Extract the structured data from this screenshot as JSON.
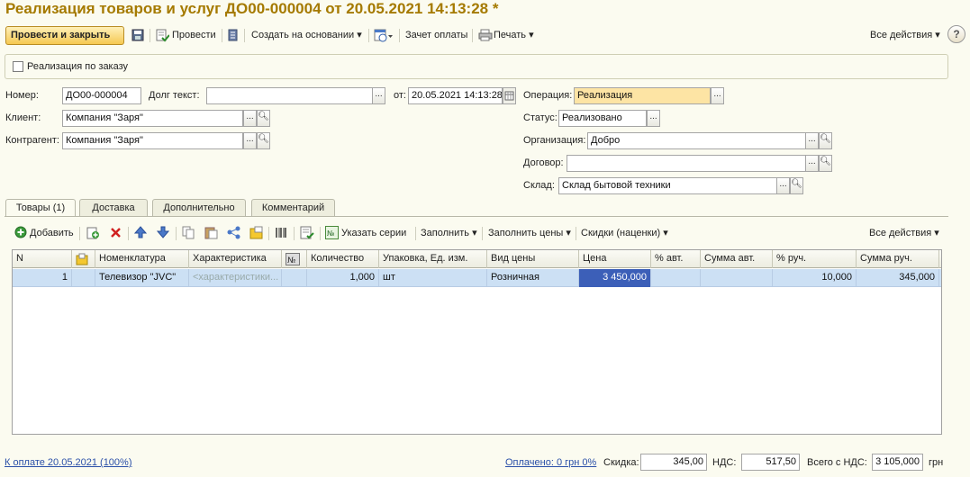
{
  "title": "Реализация товаров и услуг ДО00-000004 от 20.05.2021 14:13:28 *",
  "toolbar": {
    "post_close": "Провести и закрыть",
    "post": "Провести",
    "create_based": "Создать на основании",
    "payment_offset": "Зачет оплаты",
    "print": "Печать",
    "all_actions": "Все действия",
    "help": "?"
  },
  "by_order": {
    "label": "Реализация по заказу",
    "checked": false
  },
  "form": {
    "number_label": "Номер:",
    "number_value": "ДО00-000004",
    "debt_label": "Долг текст:",
    "debt_value": "",
    "date_label": "от:",
    "date_value": "20.05.2021 14:13:28",
    "operation_label": "Операция:",
    "operation_value": "Реализация",
    "client_label": "Клиент:",
    "client_value": "Компания \"Заря\"",
    "status_label": "Статус:",
    "status_value": "Реализовано",
    "counterparty_label": "Контрагент:",
    "counterparty_value": "Компания \"Заря\"",
    "organization_label": "Организация:",
    "organization_value": "Добро",
    "contract_label": "Договор:",
    "contract_value": "",
    "warehouse_label": "Склад:",
    "warehouse_value": "Склад бытовой техники"
  },
  "tabs": [
    {
      "label": "Товары (1)",
      "active": true
    },
    {
      "label": "Доставка",
      "active": false
    },
    {
      "label": "Дополнительно",
      "active": false
    },
    {
      "label": "Комментарий",
      "active": false
    }
  ],
  "grid_toolbar": {
    "add": "Добавить",
    "specify_series": "Указать серии",
    "fill": "Заполнить",
    "fill_prices": "Заполнить цены",
    "discounts": "Скидки (наценки)",
    "all_actions": "Все действия"
  },
  "grid": {
    "columns": [
      "N",
      "",
      "Номенклатура",
      "Характеристика",
      "",
      "Количество",
      "Упаковка, Ед. изм.",
      "Вид цены",
      "Цена",
      "% авт.",
      "Сумма авт.",
      "% руч.",
      "Сумма руч."
    ],
    "rows": [
      [
        "1",
        "",
        "Телевизор \"JVC\"",
        "<характеристики...",
        "",
        "1,000",
        "шт",
        "Розничная",
        "3 450,000",
        "",
        "",
        "10,000",
        "345,000"
      ]
    ]
  },
  "footer": {
    "to_pay": "К оплате 20.05.2021 (100%)",
    "paid": "Оплачено: 0 грн  0%",
    "discount_label": "Скидка:",
    "discount_value": "345,00",
    "vat_label": "НДС:",
    "vat_value": "517,50",
    "total_label": "Всего с НДС:",
    "total_value": "3 105,000",
    "currency": "грн"
  }
}
